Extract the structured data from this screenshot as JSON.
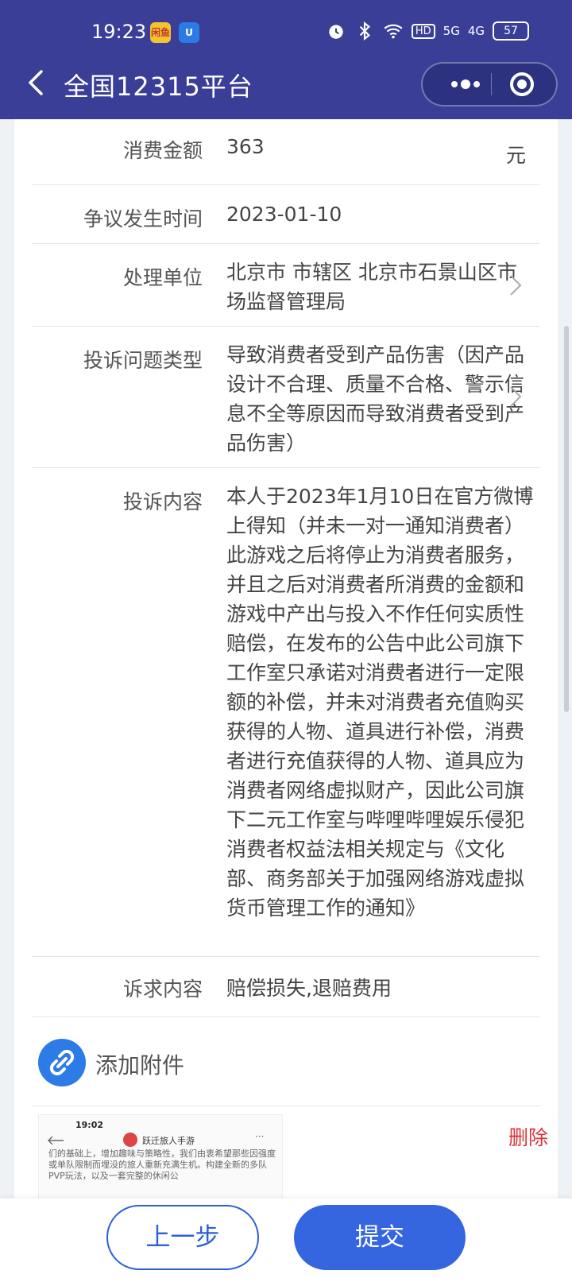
{
  "status_bar": {
    "time": "19:23",
    "app_badge_1": "闲鱼",
    "app_badge_2": "U",
    "hd_label": "HD",
    "signal_1": "5G",
    "signal_2": "4G",
    "battery": "57"
  },
  "header": {
    "title": "全国12315平台"
  },
  "form": {
    "amount": {
      "label": "消费金额",
      "value": "363",
      "unit": "元"
    },
    "dispute_time": {
      "label": "争议发生时间",
      "value": "2023-01-10"
    },
    "handler": {
      "label": "处理单位",
      "value": "北京市 市辖区 北京市石景山区市场监督管理局"
    },
    "issue_type": {
      "label": "投诉问题类型",
      "value": "导致消费者受到产品伤害（因产品设计不合理、质量不合格、警示信息不全等原因而导致消费者受到产品伤害）"
    },
    "complaint": {
      "label": "投诉内容",
      "value": "本人于2023年1月10日在官方微博上得知（并未一对一通知消费者）此游戏之后将停止为消费者服务，并且之后对消费者所消费的金额和游戏中产出与投入不作任何实质性赔偿，在发布的公告中此公司旗下工作室只承诺对消费者进行一定限额的补偿，并未对消费者充值购买获得的人物、道具进行补偿，消费者进行充值获得的人物、道具应为消费者网络虚拟财产，因此公司旗下二元工作室与哔哩哔哩娱乐侵犯消费者权益法相关规定与《文化部、商务部关于加强网络游戏虚拟货币管理工作的通知》"
    },
    "demand": {
      "label": "诉求内容",
      "value": "赔偿损失,退赔费用"
    }
  },
  "attachment": {
    "add_label": "添加附件",
    "delete_label": "删除",
    "thumb_time": "19:02",
    "thumb_name": "跃迁旅人手游",
    "thumb_text": "们的基础上，增加趣味与策略性，我们由衷希望那些因强度或单队限制而埋没的旅人重新充满生机。构建全新的多队PVP玩法，以及一套完整的休闲公"
  },
  "buttons": {
    "prev": "上一步",
    "submit": "提交"
  },
  "colors": {
    "header_bg": "#3a3e96",
    "primary": "#3565df",
    "danger": "#d9363e"
  }
}
